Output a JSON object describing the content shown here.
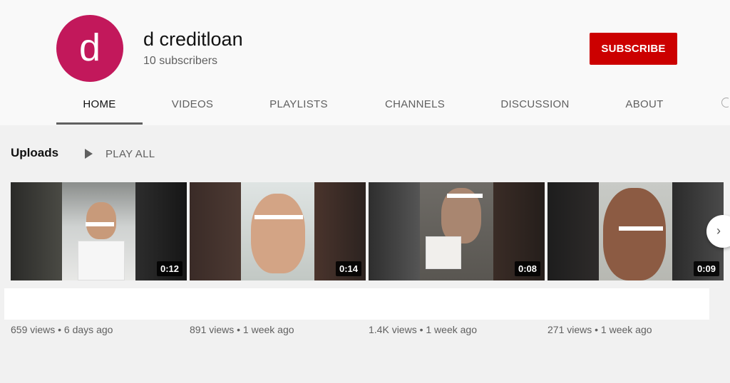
{
  "channel": {
    "avatar_letter": "d",
    "name": "d creditloan",
    "subscribers": "10 subscribers",
    "subscribe_label": "SUBSCRIBE",
    "accent_color": "#cc0000",
    "avatar_color": "#c2185b"
  },
  "tabs": [
    {
      "label": "HOME",
      "active": true
    },
    {
      "label": "VIDEOS",
      "active": false
    },
    {
      "label": "PLAYLISTS",
      "active": false
    },
    {
      "label": "CHANNELS",
      "active": false
    },
    {
      "label": "DISCUSSION",
      "active": false
    },
    {
      "label": "ABOUT",
      "active": false
    }
  ],
  "uploads": {
    "title": "Uploads",
    "play_all_label": "PLAY ALL",
    "videos": [
      {
        "duration": "0:12",
        "meta": "659 views • 6 days ago"
      },
      {
        "duration": "0:14",
        "meta": "891 views • 1 week ago"
      },
      {
        "duration": "0:08",
        "meta": "1.4K views • 1 week ago"
      },
      {
        "duration": "0:09",
        "meta": "271 views • 1 week ago"
      }
    ]
  },
  "icons": {
    "play": "play-icon",
    "next": "chevron-right-icon",
    "more_tabs": "search-icon"
  }
}
